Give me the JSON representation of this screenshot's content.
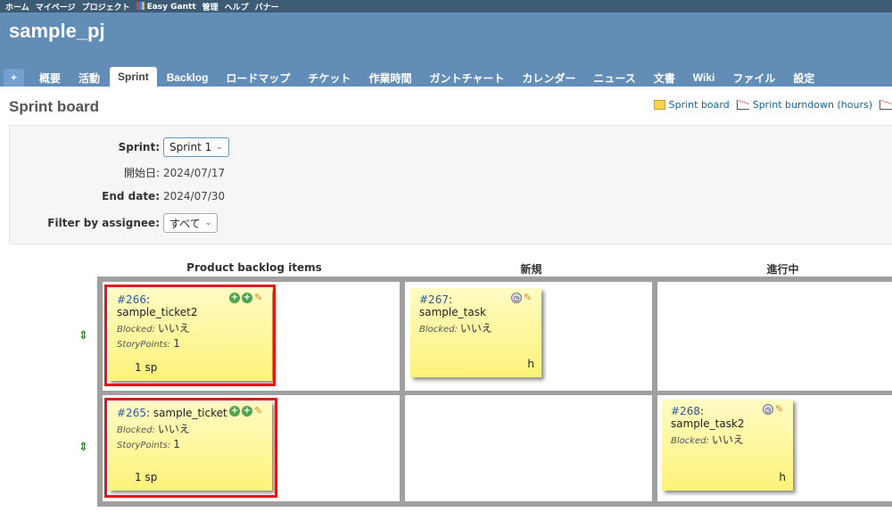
{
  "top_menu": [
    "ホーム",
    "マイページ",
    "プロジェクト",
    "Easy Gantt",
    "管理",
    "ヘルプ",
    "バナー"
  ],
  "project_title": "sample_pj",
  "tabs": [
    "+",
    "概要",
    "活動",
    "Sprint",
    "Backlog",
    "ロードマップ",
    "チケット",
    "作業時間",
    "ガントチャート",
    "カレンダー",
    "ニュース",
    "文書",
    "Wiki",
    "ファイル",
    "設定"
  ],
  "selected_tab": "Sprint",
  "page_title": "Sprint board",
  "links": {
    "sprint_board": "Sprint board",
    "burndown": "Sprint burndown (hours)"
  },
  "filters": {
    "sprint_label": "Sprint:",
    "sprint_value": "Sprint 1",
    "start_label": "開始日:",
    "start_value": "2024/07/17",
    "end_label": "End date:",
    "end_value": "2024/07/30",
    "assignee_label": "Filter by assignee:",
    "assignee_value": "すべて"
  },
  "columns": [
    "Product backlog items",
    "新規",
    "進行中"
  ],
  "cards": {
    "c266": {
      "id": "#266",
      "title": "sample_ticket2",
      "blocked_label": "Blocked:",
      "blocked_value": "いいえ",
      "sp_label": "StoryPoints:",
      "sp_value": "1",
      "footer": "1 sp"
    },
    "c265": {
      "id": "#265",
      "title": "sample_ticket",
      "blocked_label": "Blocked:",
      "blocked_value": "いいえ",
      "sp_label": "StoryPoints:",
      "sp_value": "1",
      "footer": "1 sp"
    },
    "c267": {
      "id": "#267",
      "title": "sample_task",
      "blocked_label": "Blocked:",
      "blocked_value": "いいえ",
      "footer": "h"
    },
    "c268": {
      "id": "#268",
      "title": "sample_task2",
      "blocked_label": "Blocked:",
      "blocked_value": "いいえ",
      "footer": "h"
    }
  },
  "colors": {
    "header": "#628db6",
    "top_menu": "#3e5b76",
    "highlight": "#e01818",
    "card": "#fdf37a"
  },
  "icons": [
    "move-icon",
    "add-task-icon",
    "timer-icon",
    "edit-icon",
    "board-icon",
    "chart-icon"
  ]
}
